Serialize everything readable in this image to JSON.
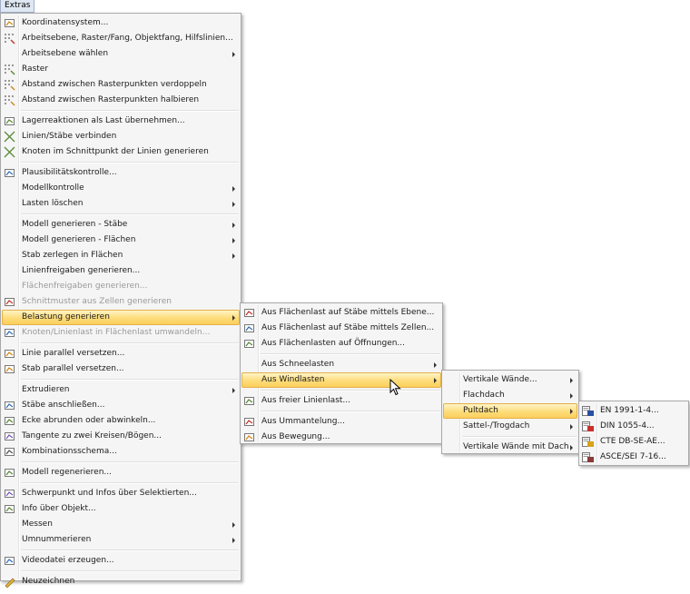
{
  "menubar": {
    "extras_label": "Extras"
  },
  "main_menu": [
    {
      "label": "Koordinatensystem...",
      "icon": "coordinate-system-icon"
    },
    {
      "label": "Arbeitsebene, Raster/Fang, Objektfang, Hilfslinien...",
      "icon": "work-plane-grid-icon"
    },
    {
      "label": "Arbeitsebene wählen",
      "submenu": true
    },
    {
      "label": "Raster",
      "icon": "grid-icon"
    },
    {
      "label": "Abstand zwischen Rasterpunkten verdoppeln",
      "icon": "grid-double-icon"
    },
    {
      "label": "Abstand zwischen Rasterpunkten halbieren",
      "icon": "grid-half-icon"
    },
    {
      "sep": true
    },
    {
      "label": "Lagerreaktionen als Last übernehmen...",
      "icon": "support-reactions-icon"
    },
    {
      "label": "Linien/Stäbe verbinden",
      "icon": "connect-lines-icon"
    },
    {
      "label": "Knoten im Schnittpunkt der Linien generieren",
      "icon": "intersection-node-icon"
    },
    {
      "sep": true
    },
    {
      "label": "Plausibilitätskontrolle...",
      "icon": "plausibility-check-icon"
    },
    {
      "label": "Modellkontrolle",
      "submenu": true
    },
    {
      "label": "Lasten löschen",
      "submenu": true
    },
    {
      "sep": true
    },
    {
      "label": "Modell generieren - Stäbe",
      "submenu": true
    },
    {
      "label": "Modell generieren - Flächen",
      "submenu": true
    },
    {
      "label": "Stab zerlegen in Flächen",
      "submenu": true
    },
    {
      "label": "Linienfreigaben generieren..."
    },
    {
      "label": "Flächenfreigaben generieren...",
      "disabled": true
    },
    {
      "label": "Schnittmuster aus Zellen generieren",
      "disabled": true,
      "icon": "cutting-pattern-icon"
    },
    {
      "label": "Belastung generieren",
      "submenu": true,
      "highlight": true
    },
    {
      "label": "Knoten/Linienlast in Flächenlast umwandeln...",
      "disabled": true,
      "icon": "convert-load-icon"
    },
    {
      "sep": true
    },
    {
      "label": "Linie parallel versetzen...",
      "icon": "offset-line-icon"
    },
    {
      "label": "Stab parallel versetzen...",
      "icon": "offset-member-icon"
    },
    {
      "sep": true
    },
    {
      "label": "Extrudieren",
      "submenu": true
    },
    {
      "label": "Stäbe anschließen...",
      "icon": "connect-members-icon"
    },
    {
      "label": "Ecke abrunden oder abwinkeln...",
      "icon": "round-corner-icon"
    },
    {
      "label": "Tangente zu zwei Kreisen/Bögen...",
      "icon": "tangent-icon"
    },
    {
      "label": "Kombinationsschema...",
      "icon": "combination-scheme-icon"
    },
    {
      "sep": true
    },
    {
      "label": "Modell regenerieren...",
      "icon": "regenerate-model-icon"
    },
    {
      "sep": true
    },
    {
      "label": "Schwerpunkt und Infos über Selektierten...",
      "icon": "centroid-info-icon"
    },
    {
      "label": "Info über Objekt...",
      "icon": "object-info-icon"
    },
    {
      "label": "Messen",
      "submenu": true
    },
    {
      "label": "Umnummerieren",
      "submenu": true
    },
    {
      "sep": true
    },
    {
      "label": "Videodatei erzeugen...",
      "icon": "video-file-icon"
    },
    {
      "sep": true
    },
    {
      "label": "Neuzeichnen",
      "icon": "redraw-icon"
    }
  ],
  "belastung_menu": [
    {
      "label": "Aus Flächenlast auf Stäbe mittels Ebene...",
      "icon": "area-load-plane-icon"
    },
    {
      "label": "Aus Flächenlast auf Stäbe mittels Zellen...",
      "icon": "area-load-cells-icon"
    },
    {
      "label": "Aus Flächenlasten auf Öffnungen...",
      "icon": "area-load-openings-icon"
    },
    {
      "sep": true
    },
    {
      "label": "Aus Schneelasten",
      "submenu": true
    },
    {
      "label": "Aus Windlasten",
      "submenu": true,
      "highlight": true
    },
    {
      "sep": true
    },
    {
      "label": "Aus freier Linienlast...",
      "icon": "free-line-load-icon"
    },
    {
      "sep": true
    },
    {
      "label": "Aus Ummantelung...",
      "icon": "encasement-icon"
    },
    {
      "label": "Aus Bewegung...",
      "icon": "motion-icon"
    }
  ],
  "wind_menu": [
    {
      "label": "Vertikale Wände...",
      "submenu": true
    },
    {
      "label": "Flachdach",
      "submenu": true
    },
    {
      "label": "Pultdach",
      "submenu": true,
      "highlight": true
    },
    {
      "label": "Sattel-/Trogdach",
      "submenu": true
    },
    {
      "sep": true
    },
    {
      "label": "Vertikale Wände mit Dach",
      "submenu": true
    }
  ],
  "pultdach_menu": [
    {
      "label": "EN 1991-1-4...",
      "icon": "en-flag-icon"
    },
    {
      "label": "DIN 1055-4...",
      "icon": "din-flag-icon"
    },
    {
      "label": "CTE DB-SE-AE...",
      "icon": "cte-flag-icon"
    },
    {
      "label": "ASCE/SEI 7-16...",
      "icon": "asce-flag-icon"
    }
  ]
}
